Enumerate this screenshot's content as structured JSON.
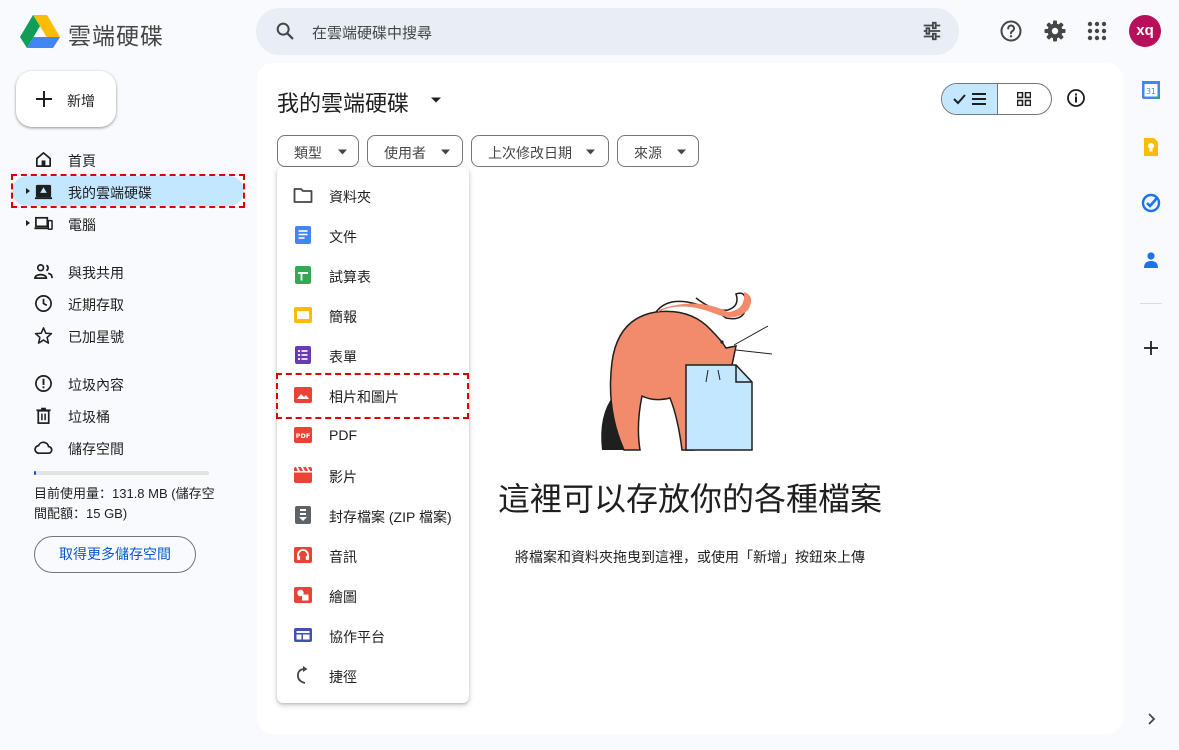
{
  "app": {
    "title": "雲端硬碟"
  },
  "search": {
    "placeholder": "在雲端硬碟中搜尋"
  },
  "header": {
    "avatar_initials": "xq"
  },
  "sidebar": {
    "new_label": "新增",
    "items": [
      {
        "label": "首頁",
        "icon": "home-icon"
      },
      {
        "label": "我的雲端硬碟",
        "icon": "my-drive-icon",
        "active": true
      },
      {
        "label": "電腦",
        "icon": "computers-icon"
      },
      {
        "label": "與我共用",
        "icon": "shared-icon"
      },
      {
        "label": "近期存取",
        "icon": "recent-icon"
      },
      {
        "label": "已加星號",
        "icon": "star-icon"
      },
      {
        "label": "垃圾內容",
        "icon": "spam-icon"
      },
      {
        "label": "垃圾桶",
        "icon": "trash-icon"
      },
      {
        "label": "儲存空間",
        "icon": "cloud-icon"
      }
    ],
    "storage_text": "目前使用量：131.8 MB (儲存空間配額：15 GB)",
    "storage_fraction": 0.009,
    "more_storage_label": "取得更多儲存空間"
  },
  "main": {
    "title": "我的雲端硬碟",
    "filters": [
      "類型",
      "使用者",
      "上次修改日期",
      "來源"
    ],
    "type_menu": [
      {
        "label": "資料夾",
        "icon": "folder-icon"
      },
      {
        "label": "文件",
        "icon": "docs-icon"
      },
      {
        "label": "試算表",
        "icon": "sheets-icon"
      },
      {
        "label": "簡報",
        "icon": "slides-icon"
      },
      {
        "label": "表單",
        "icon": "forms-icon"
      },
      {
        "label": "相片和圖片",
        "icon": "image-icon"
      },
      {
        "label": "PDF",
        "icon": "pdf-icon"
      },
      {
        "label": "影片",
        "icon": "video-icon"
      },
      {
        "label": "封存檔案 (ZIP 檔案)",
        "icon": "archive-icon"
      },
      {
        "label": "音訊",
        "icon": "audio-icon"
      },
      {
        "label": "繪圖",
        "icon": "drawing-icon"
      },
      {
        "label": "協作平台",
        "icon": "sites-icon"
      },
      {
        "label": "捷徑",
        "icon": "shortcut-icon"
      }
    ],
    "empty_title": "這裡可以存放你的各種檔案",
    "empty_subtitle": "將檔案和資料夾拖曳到這裡，或使用「新增」按鈕來上傳"
  },
  "right_rail": {
    "calendar_day": "31"
  },
  "colors": {
    "accent": "#0b57d0",
    "active_bg": "#c2e7ff",
    "highlight_border": "#e00000",
    "avatar_bg": "#b80f5a"
  }
}
